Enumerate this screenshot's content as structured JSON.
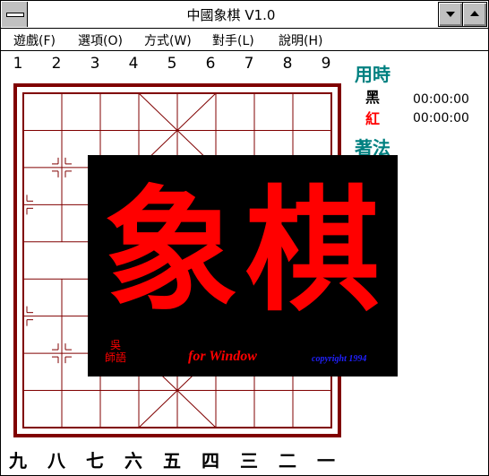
{
  "window": {
    "title": "中國象棋 V1.0"
  },
  "menu": {
    "items": [
      "遊戲(F)",
      "選項(O)",
      "方式(W)",
      "對手(L)",
      "說明(H)"
    ]
  },
  "board": {
    "column_numbers": [
      "1",
      "2",
      "3",
      "4",
      "5",
      "6",
      "7",
      "8",
      "9"
    ],
    "column_chinese": [
      "九",
      "八",
      "七",
      "六",
      "五",
      "四",
      "三",
      "二",
      "一"
    ],
    "frame_color": "#800000",
    "line_color": "#800000"
  },
  "side_panel": {
    "time_heading": "用時",
    "black_label": "黑",
    "black_time": "00:00:00",
    "red_label": "紅",
    "red_time": "00:00:00",
    "moves_heading": "著法",
    "heading_color": "#008080"
  },
  "splash": {
    "big_char_1": "象",
    "big_char_2": "棋",
    "seal_line_1": "吳",
    "seal_line_2": "師語",
    "for_window": "for Window",
    "copyright": "copyright 1994"
  }
}
